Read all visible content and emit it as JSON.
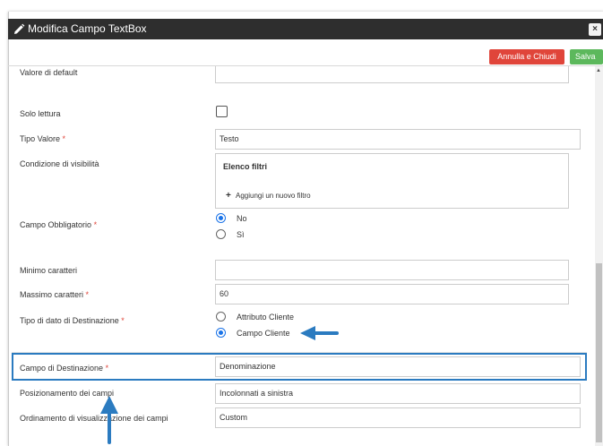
{
  "dialog": {
    "title": "Modifica Campo TextBox",
    "close_label": "×",
    "pencil_icon": "pencil-icon"
  },
  "toolbar": {
    "cancel_label": "Annulla e Chiudi",
    "save_label": "Salva",
    "cancel_color": "#e0453a",
    "save_color": "#5cb85c"
  },
  "form": {
    "default_value": {
      "label": "Valore di default",
      "value": ""
    },
    "readonly": {
      "label": "Solo lettura",
      "checked": false
    },
    "value_type": {
      "label": "Tipo Valore",
      "required": "*",
      "value": "Testo"
    },
    "visibility": {
      "label": "Condizione di visibilità",
      "box_title": "Elenco filtri",
      "add_label": "Aggiungi un nuovo filtro"
    },
    "mandatory": {
      "label": "Campo Obbligatorio",
      "required": "*",
      "options": [
        "No",
        "Sì"
      ],
      "selected": "No"
    },
    "min_chars": {
      "label": "Minimo caratteri",
      "value": ""
    },
    "max_chars": {
      "label": "Massimo caratteri",
      "required": "*",
      "value": "60"
    },
    "dest_type": {
      "label": "Tipo di dato di Destinazione",
      "required": "*",
      "options": [
        "Attributo Cliente",
        "Campo Cliente"
      ],
      "selected": "Campo Cliente"
    },
    "dest_field": {
      "label": "Campo di Destinazione",
      "required": "*",
      "value": "Denominazione"
    },
    "positioning": {
      "label": "Posizionamento dei campi",
      "value": "Incolonnati a sinistra"
    },
    "ordering": {
      "label": "Ordinamento di visualizzazione dei campi",
      "value": "Custom"
    }
  },
  "annotations": {
    "highlight_color": "#2b7bc0",
    "arrow_color": "#2b7bc0"
  }
}
